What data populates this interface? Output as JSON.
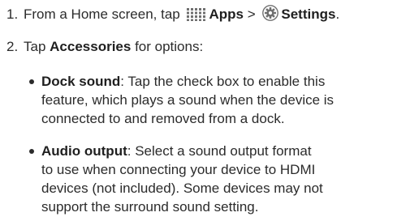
{
  "steps": [
    {
      "number": "1.",
      "prefix": "From a Home screen, tap",
      "apps_icon": "apps-grid-icon",
      "apps_label": "Apps",
      "separator": ">",
      "settings_icon": "settings-gear-icon",
      "settings_label": "Settings",
      "suffix": "."
    },
    {
      "number": "2.",
      "prefix": "Tap",
      "bold": "Accessories",
      "suffix": "for options:"
    }
  ],
  "options": [
    {
      "term": "Dock sound",
      "lines": [
        ": Tap the check box to enable this",
        "feature, which plays a sound when the device is",
        "connected to and removed from a dock."
      ]
    },
    {
      "term": "Audio output",
      "lines": [
        ": Select a sound output format",
        "to use when connecting your device to HDMI",
        "devices (not included). Some devices may not",
        "support the surround sound setting."
      ]
    }
  ],
  "colors": {
    "text": "#2b2b2b",
    "icon": "#6f6f6f"
  }
}
